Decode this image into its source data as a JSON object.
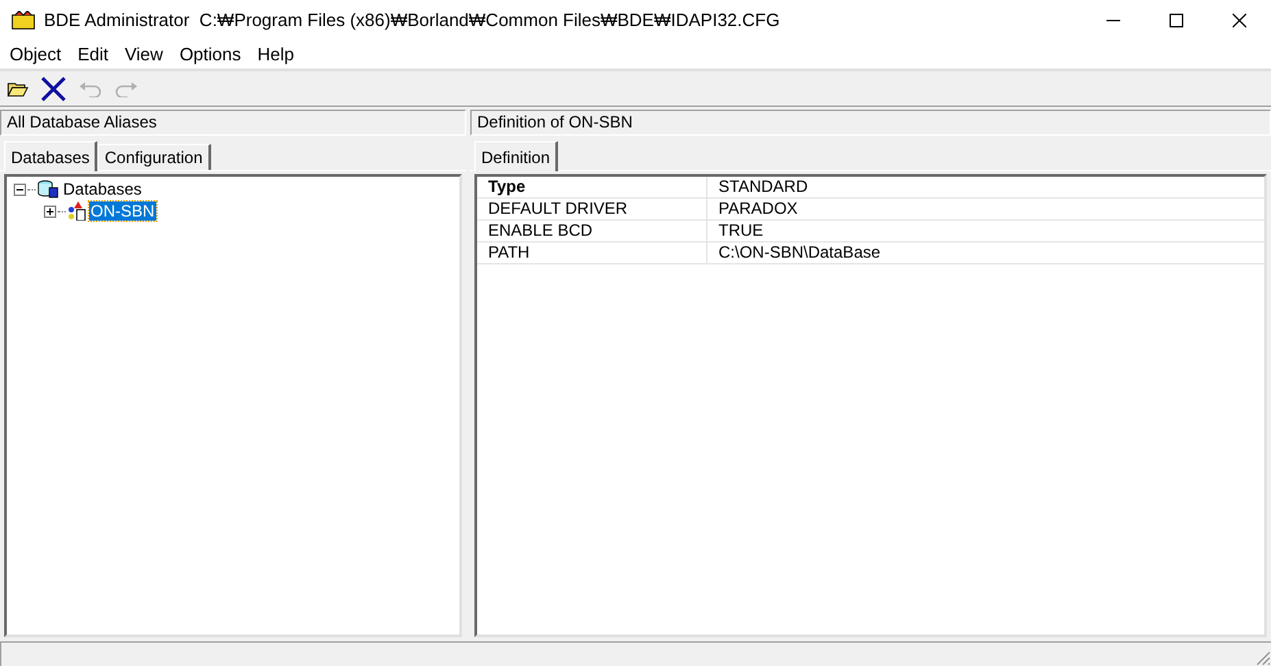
{
  "window": {
    "title": "BDE Administrator  C:₩Program Files (x86)₩Borland₩Common Files₩BDE₩IDAPI32.CFG"
  },
  "menu": [
    "Object",
    "Edit",
    "View",
    "Options",
    "Help"
  ],
  "toolbar": [
    {
      "kind": "open",
      "disabled": false
    },
    {
      "kind": "delete",
      "disabled": false
    },
    {
      "kind": "undo",
      "disabled": true
    },
    {
      "kind": "redo",
      "disabled": true
    }
  ],
  "left_panel": {
    "header": "All Database Aliases",
    "tabs": [
      {
        "label": "Databases",
        "selected": true
      },
      {
        "label": "Configuration",
        "selected": false
      }
    ],
    "tree": [
      {
        "label": "Databases",
        "kind": "root",
        "expanded": true,
        "selected": false,
        "children": [
          {
            "label": "ON-SBN",
            "kind": "alias",
            "expanded": false,
            "selected": true
          }
        ]
      }
    ]
  },
  "right_panel": {
    "header": "Definition of ON-SBN",
    "tabs": [
      {
        "label": "Definition",
        "selected": true
      }
    ],
    "rows": [
      {
        "name": "Type",
        "value": "STANDARD",
        "kind": "header"
      },
      {
        "name": "DEFAULT DRIVER",
        "value": "PARADOX",
        "kind": "property"
      },
      {
        "name": "ENABLE BCD",
        "value": "TRUE",
        "kind": "property"
      },
      {
        "name": "PATH",
        "value": "C:\\ON-SBN\\DataBase",
        "kind": "property"
      }
    ]
  }
}
